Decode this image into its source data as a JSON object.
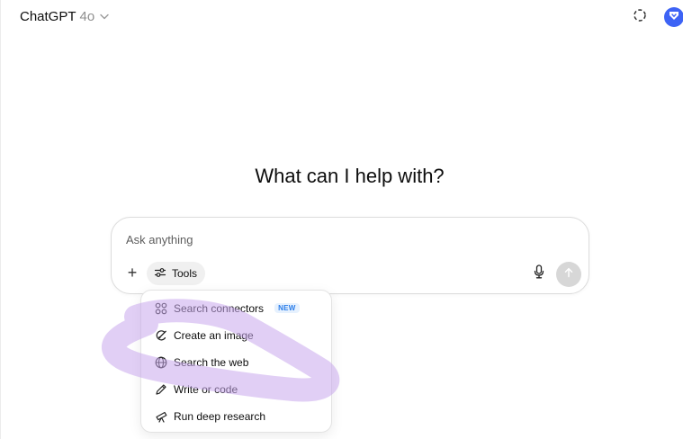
{
  "header": {
    "model_name": "ChatGPT",
    "model_version": "4o",
    "model_chevron_icon": "chevron-down-icon",
    "temporary_chat_icon": "dashed-circle-icon",
    "profile_icon": "avatar-icon",
    "profile_color": "#3d63f5"
  },
  "main": {
    "heading": "What can I help with?"
  },
  "composer": {
    "placeholder": "Ask anything",
    "value": "",
    "plus_label": "+",
    "tools_label": "Tools",
    "mic_icon": "microphone-icon",
    "send_icon": "arrow-up-icon"
  },
  "tools_menu": {
    "items": [
      {
        "label": "Search connectors",
        "icon": "connectors-icon",
        "badge": "NEW"
      },
      {
        "label": "Create an image",
        "icon": "image-brush-icon"
      },
      {
        "label": "Search the web",
        "icon": "globe-icon"
      },
      {
        "label": "Write or code",
        "icon": "pen-icon"
      },
      {
        "label": "Run deep research",
        "icon": "telescope-icon"
      }
    ]
  },
  "annotation": {
    "scribble_color": "#c9a8ec"
  }
}
